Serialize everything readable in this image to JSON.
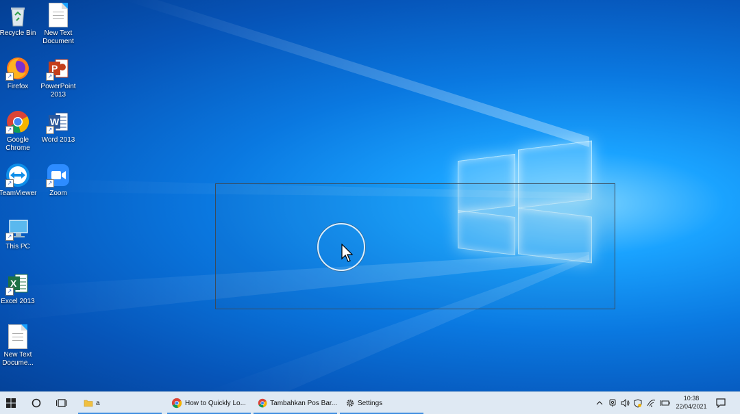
{
  "desktop": {
    "icons": [
      {
        "label": "Recycle Bin",
        "icon": "recycle-bin-icon"
      },
      {
        "label": "New Text Document",
        "icon": "text-document-icon"
      },
      {
        "label": "Firefox",
        "icon": "firefox-icon"
      },
      {
        "label": "PowerPoint 2013",
        "icon": "powerpoint-icon"
      },
      {
        "label": "Google Chrome",
        "icon": "chrome-icon"
      },
      {
        "label": "Word 2013",
        "icon": "word-icon"
      },
      {
        "label": "TeamViewer",
        "icon": "teamviewer-icon"
      },
      {
        "label": "Zoom",
        "icon": "zoom-icon"
      },
      {
        "label": "This PC",
        "icon": "computer-icon"
      },
      {
        "label": "Excel 2013",
        "icon": "excel-icon"
      },
      {
        "label": "New Text Docume...",
        "icon": "text-document-icon"
      }
    ],
    "powerpoint_letter": "P",
    "word_letter": "W",
    "excel_letter": "X"
  },
  "taskbar": {
    "start_icon": "windows-start-icon",
    "search_icon": "cortana-circle-icon",
    "taskview_icon": "task-view-icon",
    "tasks": [
      {
        "label": "a",
        "icon": "folder-icon"
      },
      {
        "label": "How to Quickly Lo...",
        "icon": "chrome-icon"
      },
      {
        "label": "Tambahkan Pos Bar...",
        "icon": "chrome-icon"
      },
      {
        "label": "Settings",
        "icon": "gear-icon"
      }
    ],
    "tray": {
      "time": "10:38",
      "date": "22/04/2021",
      "icons": [
        "chevron-up-icon",
        "meet-now-icon",
        "volume-icon",
        "shield-icon",
        "wifi-icon",
        "battery-icon"
      ],
      "notification_icon": "notification-icon"
    }
  },
  "colors": {
    "accent": "#3f8ee0",
    "taskbar": "#dfe9f3",
    "desktop": "#0a78e0"
  }
}
